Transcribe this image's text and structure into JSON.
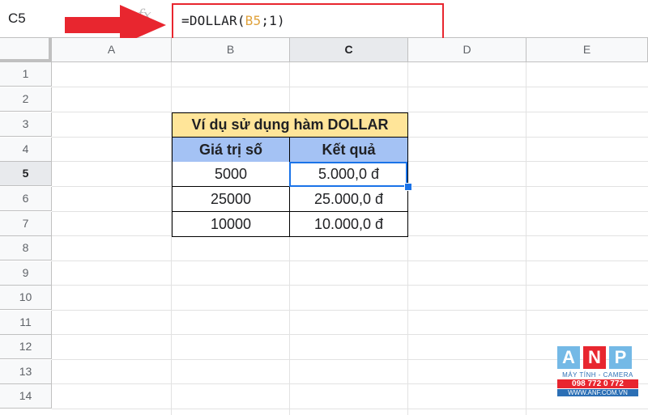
{
  "formula_bar": {
    "name_box": "C5",
    "fx": "fx",
    "formula_prefix": "=DOLLAR(",
    "formula_ref": "B5",
    "formula_suffix": ";1)"
  },
  "columns": [
    "A",
    "B",
    "C",
    "D",
    "E"
  ],
  "rows": [
    "1",
    "2",
    "3",
    "4",
    "5",
    "6",
    "7",
    "8",
    "9",
    "10",
    "11",
    "12",
    "13",
    "14"
  ],
  "table": {
    "title": "Ví dụ sử dụng hàm DOLLAR",
    "headers": [
      "Giá trị số",
      "Kết quả"
    ],
    "rows": [
      [
        "5000",
        "5.000,0 đ"
      ],
      [
        "25000",
        "25.000,0 đ"
      ],
      [
        "10000",
        "10.000,0 đ"
      ]
    ]
  },
  "colors": {
    "title_fill": "#ffe599",
    "header_fill": "#a4c2f4",
    "selection": "#1a73e8",
    "highlight_box": "#e8262f",
    "arrow": "#e8262f"
  },
  "logo": {
    "letters": [
      "A",
      "N",
      "P"
    ],
    "line1": "MÁY TÍNH - CAMERA",
    "line2": "098 772 0 772",
    "line3": "WWW.ANF.COM.VN"
  }
}
